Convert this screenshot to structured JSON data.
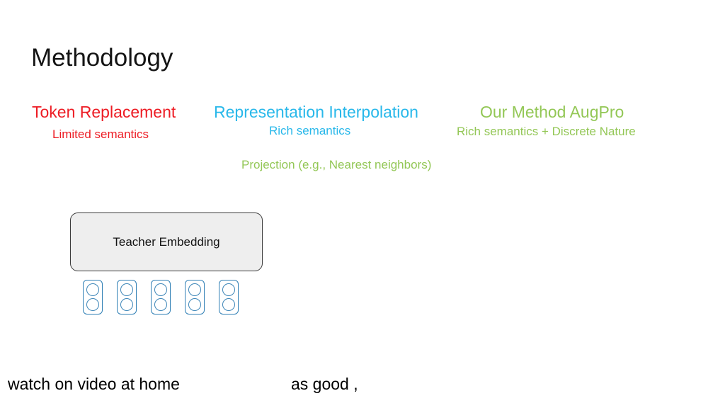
{
  "slide": {
    "title": "Methodology"
  },
  "approaches": [
    {
      "name": "token-replacement",
      "heading": "Token Replacement",
      "subheading": "Limited semantics",
      "color": "#ed1c24"
    },
    {
      "name": "representation-interpolation",
      "heading": "Representation Interpolation",
      "subheading": "Rich semantics",
      "color": "#29b8ea"
    },
    {
      "name": "our-method",
      "heading": "Our Method AugPro",
      "subheading": "Rich semantics + Discrete Nature",
      "color": "#93c756"
    }
  ],
  "projection": {
    "note": "Projection (e.g., Nearest neighbors)",
    "color": "#93c756"
  },
  "diagram": {
    "teacher_embedding_label": "Teacher Embedding",
    "box_fill": "#eeeeee",
    "box_border": "#3b3b3b",
    "token_border": "#2f7fb5",
    "tokens": [
      {
        "id": "token-1"
      },
      {
        "id": "token-2"
      },
      {
        "id": "token-3"
      },
      {
        "id": "token-4"
      },
      {
        "id": "token-5"
      }
    ]
  },
  "caption": {
    "left": "watch on video at home",
    "right": "as good ,"
  }
}
